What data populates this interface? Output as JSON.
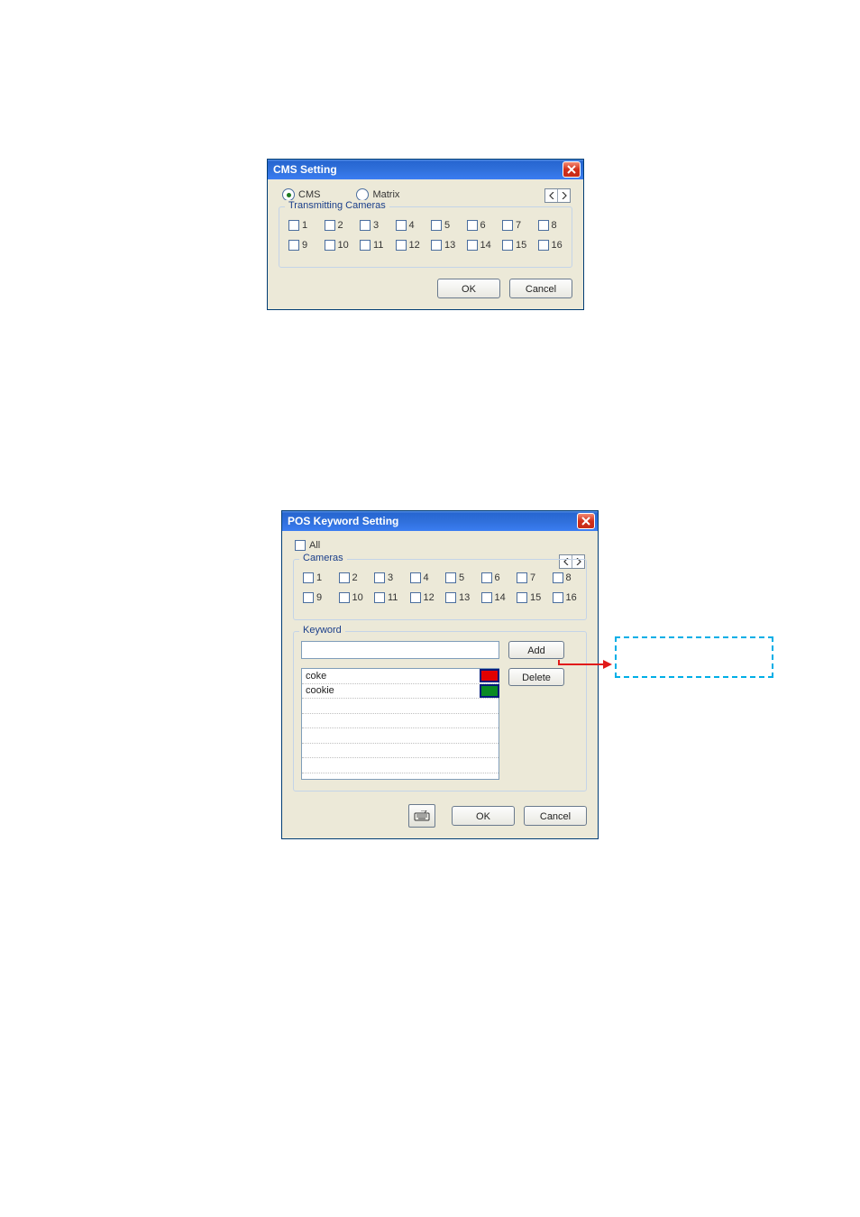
{
  "cms_dialog": {
    "title": "CMS Setting",
    "radios": {
      "cms": "CMS",
      "matrix": "Matrix",
      "selected": "cms"
    },
    "group_label": "Transmitting Cameras",
    "cameras_row1": [
      "1",
      "2",
      "3",
      "4",
      "5",
      "6",
      "7",
      "8"
    ],
    "cameras_row2": [
      "9",
      "10",
      "11",
      "12",
      "13",
      "14",
      "15",
      "16"
    ],
    "ok": "OK",
    "cancel": "Cancel"
  },
  "pos_dialog": {
    "title": "POS Keyword Setting",
    "all_label": "All",
    "cameras_label": "Cameras",
    "cameras_row1": [
      "1",
      "2",
      "3",
      "4",
      "5",
      "6",
      "7",
      "8"
    ],
    "cameras_row2": [
      "9",
      "10",
      "11",
      "12",
      "13",
      "14",
      "15",
      "16"
    ],
    "keyword_label": "Keyword",
    "add": "Add",
    "delete": "Delete",
    "keywords": [
      {
        "text": "coke",
        "color": "#e20000"
      },
      {
        "text": "cookie",
        "color": "#0a8a23"
      }
    ],
    "ok": "OK",
    "cancel": "Cancel"
  }
}
